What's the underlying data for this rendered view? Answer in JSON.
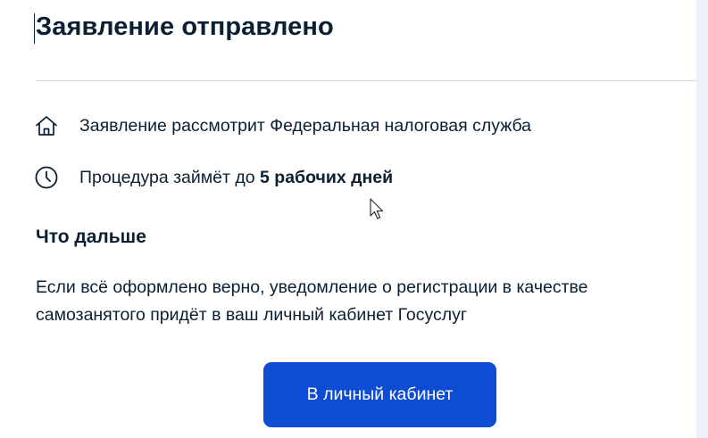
{
  "header": {
    "title": "Заявление отправлено"
  },
  "info": {
    "agency_text": "Заявление рассмотрит Федеральная налоговая служба",
    "agency_icon": "home-icon",
    "duration_prefix": "Процедура займёт до ",
    "duration_bold": "5 рабочих дней",
    "duration_icon": "clock-icon"
  },
  "next": {
    "title": "Что дальше",
    "text": "Если всё оформлено верно, уведомление о регистрации в качестве самозанятого придёт в ваш личный кабинет Госуслуг"
  },
  "actions": {
    "cabinet_label": "В личный кабинет"
  },
  "colors": {
    "primary": "#0d4cd3",
    "text": "#0b1f33",
    "divider": "#d6dce8",
    "page_background": "#eef2f8"
  }
}
